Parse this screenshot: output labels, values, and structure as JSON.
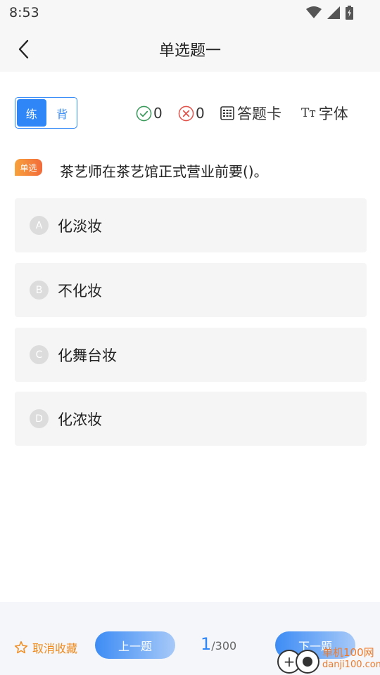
{
  "status": {
    "time": "8:53"
  },
  "nav": {
    "title": "单选题一"
  },
  "mode": {
    "practice": "练",
    "memorize": "背"
  },
  "stats": {
    "correct": "0",
    "wrong": "0"
  },
  "tools": {
    "answer_card": "答题卡",
    "font_icon_label": "Tт",
    "font": "字体"
  },
  "question": {
    "badge": "单选",
    "text": "茶艺师在茶艺馆正式营业前要()。",
    "options": [
      {
        "letter": "A",
        "text": "化淡妆"
      },
      {
        "letter": "B",
        "text": "不化妆"
      },
      {
        "letter": "C",
        "text": "化舞台妆"
      },
      {
        "letter": "D",
        "text": "化浓妆"
      }
    ]
  },
  "bottom": {
    "favorite": "取消收藏",
    "prev": "上一题",
    "current": "1",
    "total": "/300",
    "next": "下一题"
  },
  "watermark": {
    "line1": "单机100网",
    "line2": "danji100.com"
  },
  "colors": {
    "accent": "#2f86f6",
    "correct": "#3a9a5b",
    "wrong": "#e0524a",
    "favorite": "#f08a1c"
  }
}
